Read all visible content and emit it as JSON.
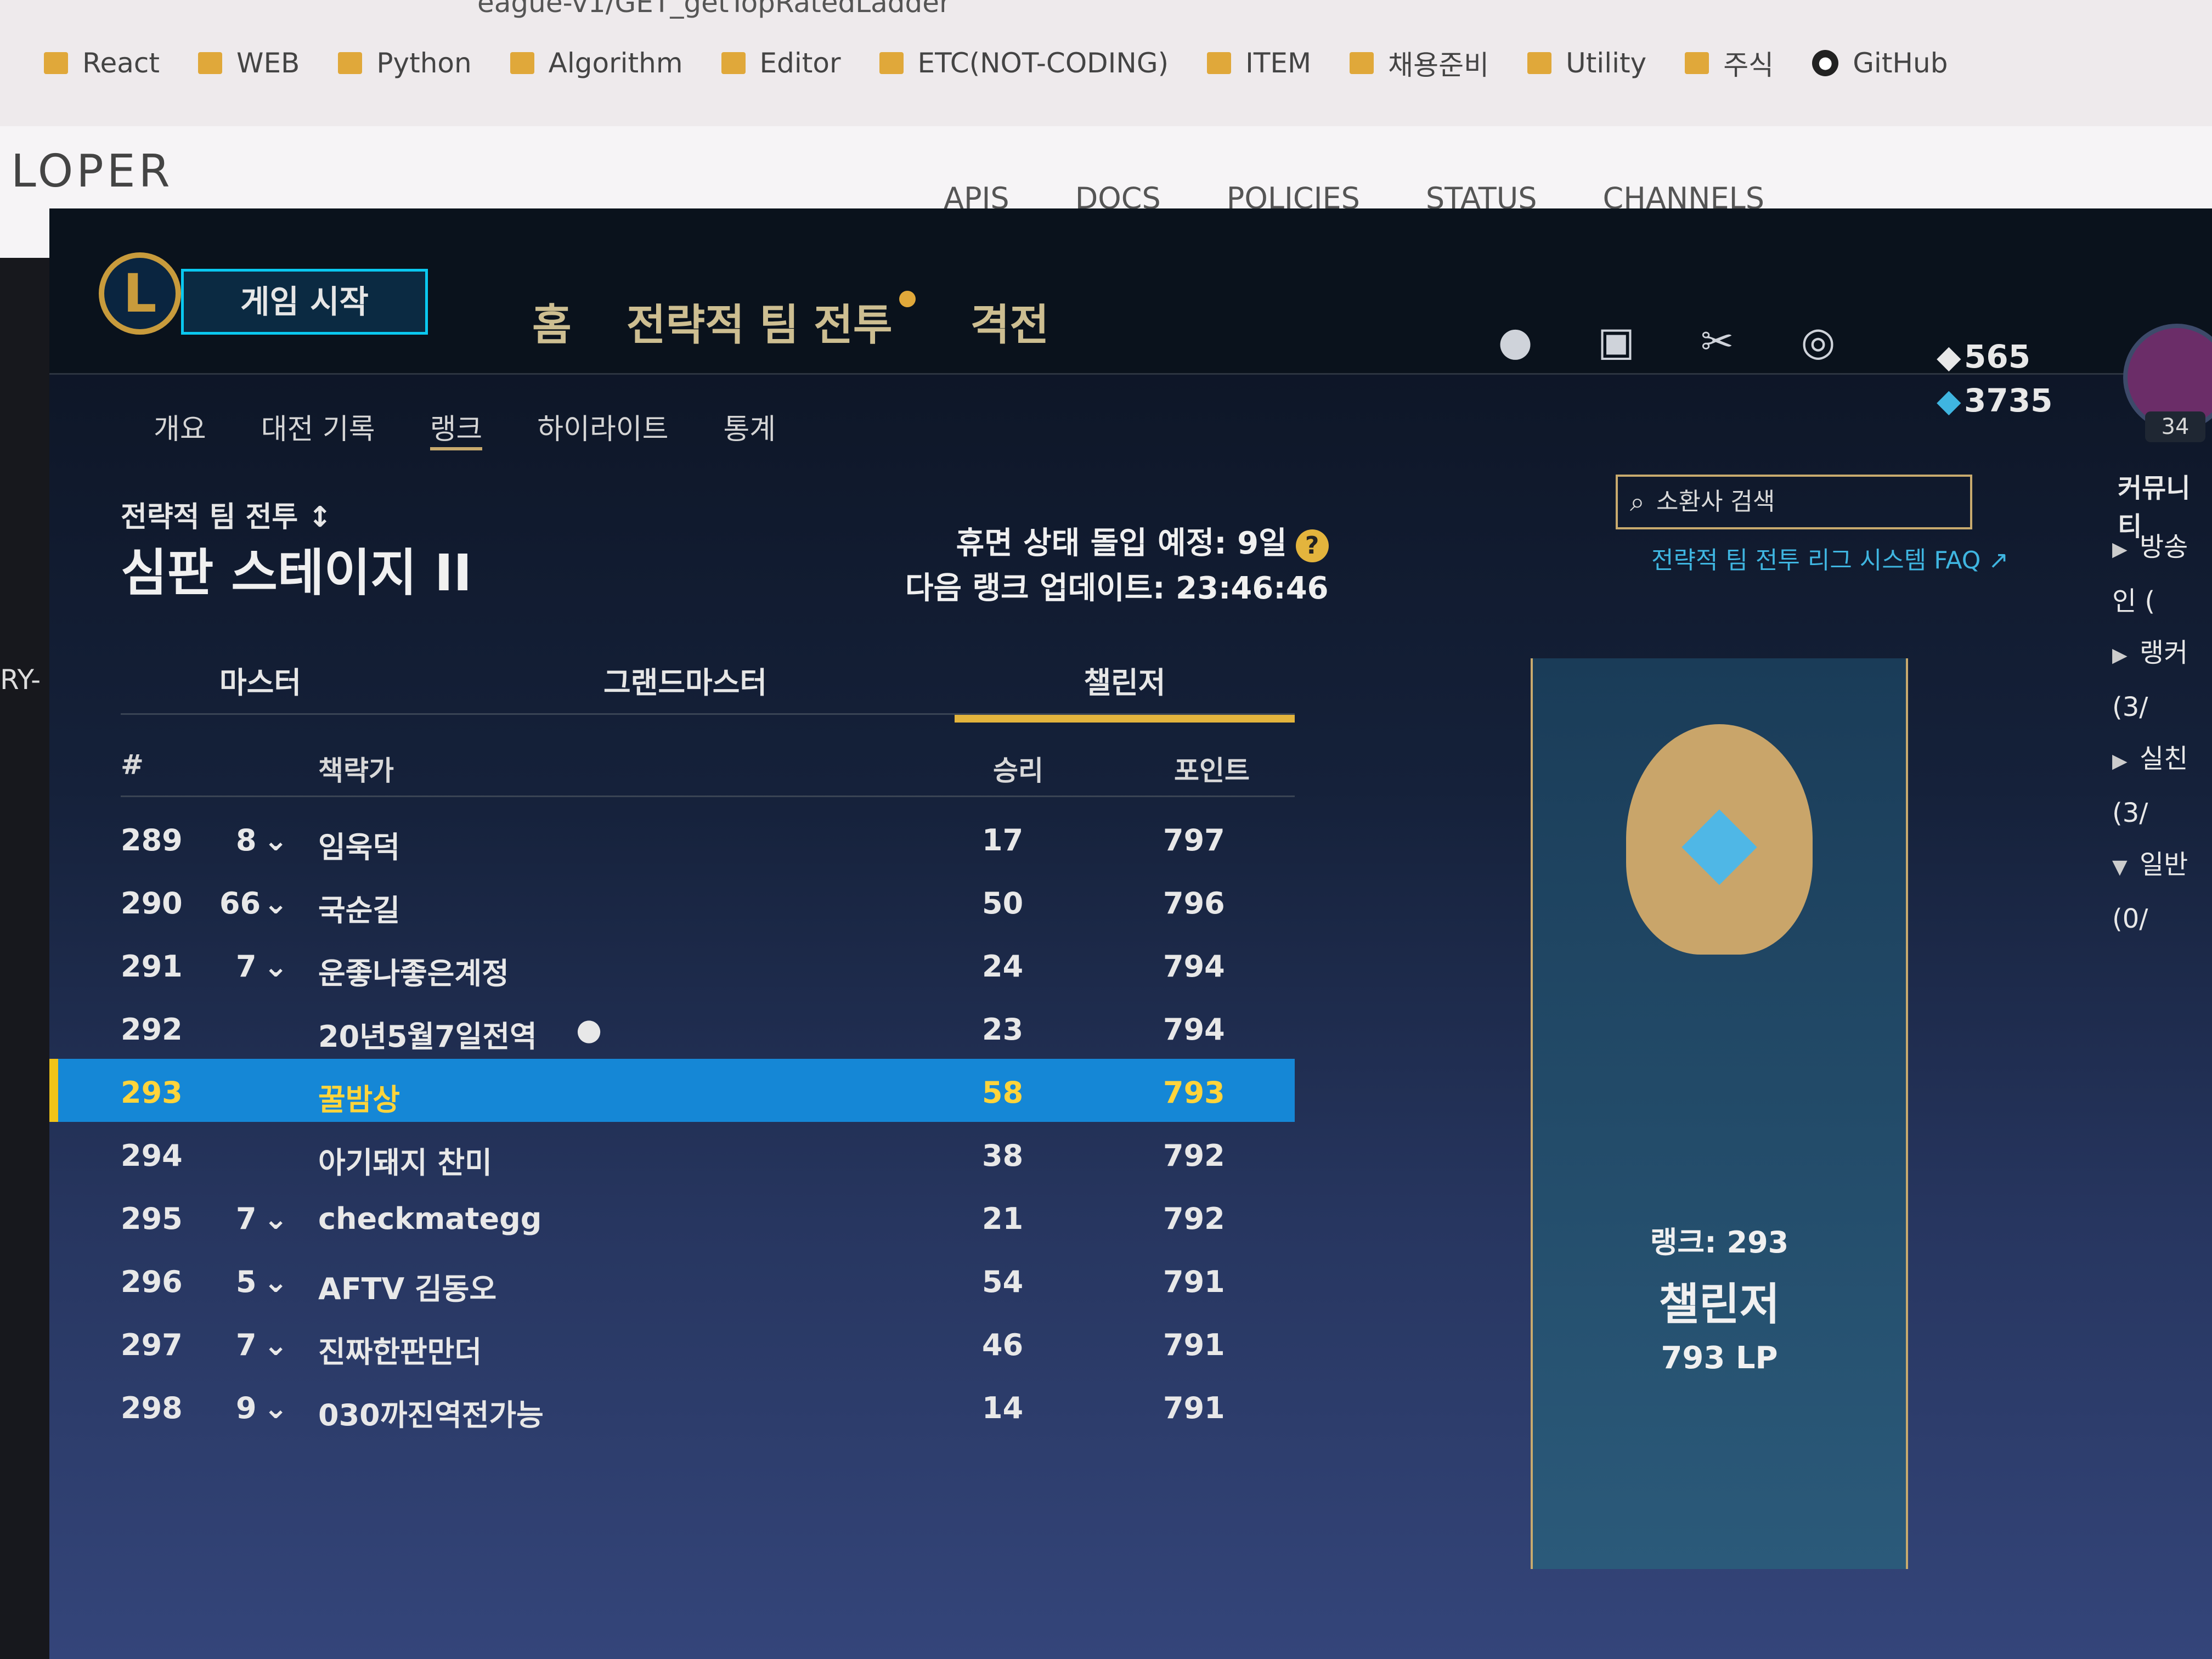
{
  "browser": {
    "url_fragment": "eague-v1/GET_getTopRatedLadder",
    "bookmarks": [
      "React",
      "WEB",
      "Python",
      "Algorithm",
      "Editor",
      "ETC(NOT-CODING)",
      "ITEM",
      "채용준비",
      "Utility",
      "주식"
    ],
    "github_label": "GitHub"
  },
  "devsite": {
    "logo": "LOPER",
    "nav": [
      "APIS",
      "DOCS",
      "POLICIES",
      "STATUS",
      "CHANNELS"
    ]
  },
  "left_edge_text": "RY-",
  "client": {
    "play_button": "게임 시작",
    "nav": {
      "home": "홈",
      "tft": "전략적 팀 전투",
      "clash": "격전"
    },
    "currency": {
      "rp": "565",
      "be": "3735"
    },
    "level": "34",
    "subnav": [
      "개요",
      "대전 기록",
      "랭크",
      "하이라이트",
      "통계"
    ],
    "subnav_active": "랭크",
    "mode_label": "전략적 팀 전투 ↕",
    "tier_label": "심판 스테이지 II",
    "decay_label": "휴면 상태 돌입 예정:",
    "decay_value": "9일",
    "update_label": "다음 랭크 업데이트:",
    "update_value": "23:46:46",
    "search_placeholder": "소환사 검색",
    "faq_link": "전략적 팀 전투 리그 시스템 FAQ ↗",
    "tier_tabs": [
      "마스터",
      "그랜드마스터",
      "챌린저"
    ],
    "tier_tab_active": "챌린저",
    "columns": {
      "rank": "#",
      "name": "책략가",
      "wins": "승리",
      "points": "포인트"
    },
    "rows": [
      {
        "rank": "289",
        "change": "8",
        "name": "임욱덕",
        "wins": "17",
        "points": "797"
      },
      {
        "rank": "290",
        "change": "66",
        "name": "국순길",
        "wins": "50",
        "points": "796"
      },
      {
        "rank": "291",
        "change": "7",
        "name": "운좋나좋은계정",
        "wins": "24",
        "points": "794"
      },
      {
        "rank": "292",
        "change": "",
        "name": "20년5월7일전역",
        "wins": "23",
        "points": "794"
      },
      {
        "rank": "293",
        "change": "",
        "name": "꿀밤상",
        "wins": "58",
        "points": "793",
        "selected": true
      },
      {
        "rank": "294",
        "change": "",
        "name": "아기돼지 찬미",
        "wins": "38",
        "points": "792"
      },
      {
        "rank": "295",
        "change": "7",
        "name": "checkmategg",
        "wins": "21",
        "points": "792"
      },
      {
        "rank": "296",
        "change": "5",
        "name": "AFTV 김동오",
        "wins": "54",
        "points": "791"
      },
      {
        "rank": "297",
        "change": "7",
        "name": "진짜한판만더",
        "wins": "46",
        "points": "791"
      },
      {
        "rank": "298",
        "change": "9",
        "name": "030까진역전가능",
        "wins": "14",
        "points": "791"
      }
    ],
    "banner": {
      "rank_line": "랭크: 293",
      "tier": "챌린저",
      "lp": "793 LP"
    },
    "community": {
      "title": "커뮤니티",
      "items": [
        "방송인 (",
        "랭커 (3/",
        "실친 (3/",
        "일반 (0/"
      ]
    },
    "colors": {
      "accent_gold": "#c8aa6e",
      "selected_row": "#1587d6",
      "challenger_tab": "#e3b43d"
    }
  }
}
